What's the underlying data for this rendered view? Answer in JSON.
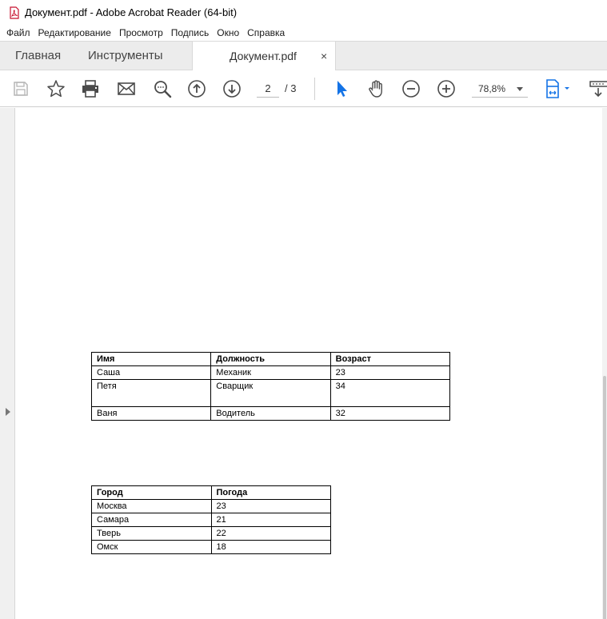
{
  "window": {
    "title": "Документ.pdf - Adobe Acrobat Reader (64-bit)",
    "app_icon": "pdf-icon"
  },
  "menu": [
    "Файл",
    "Редактирование",
    "Просмотр",
    "Подпись",
    "Окно",
    "Справка"
  ],
  "tabs": {
    "home": "Главная",
    "tools": "Инструменты",
    "document": "Документ.pdf",
    "close": "×"
  },
  "toolbar": {
    "icons": [
      "save-icon",
      "star-icon",
      "print-icon",
      "mail-icon",
      "search-icon",
      "page-up-icon",
      "page-down-icon",
      "cursor-icon",
      "hand-icon",
      "zoom-out-icon",
      "zoom-in-icon",
      "fit-page-icon",
      "scroll-mode-icon"
    ],
    "page_current": "2",
    "page_total": "/ 3",
    "zoom": "78,8%",
    "accent_color": "#1473e6"
  },
  "document": {
    "table1": {
      "headers": [
        "Имя",
        "Должность",
        "Возраст"
      ],
      "rows": [
        [
          "Саша",
          "Механик",
          "23"
        ],
        [
          "Петя",
          "Сварщик",
          "34"
        ],
        [
          "Ваня",
          "Водитель",
          "32"
        ]
      ]
    },
    "table2": {
      "headers": [
        "Город",
        "Погода"
      ],
      "rows": [
        [
          "Москва",
          "23"
        ],
        [
          "Самара",
          "21"
        ],
        [
          "Тверь",
          "22"
        ],
        [
          "Омск",
          "18"
        ]
      ]
    }
  }
}
